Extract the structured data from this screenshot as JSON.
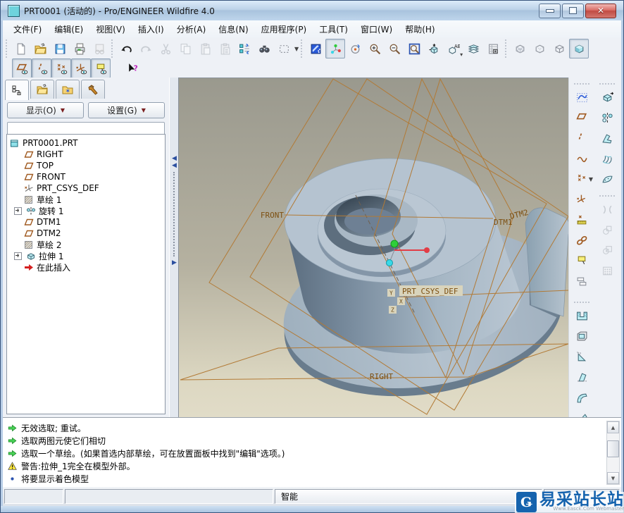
{
  "title_bar": {
    "title": "PRT0001 (活动的) - Pro/ENGINEER Wildfire 4.0"
  },
  "menu_bar": {
    "items": [
      "文件(F)",
      "编辑(E)",
      "视图(V)",
      "插入(I)",
      "分析(A)",
      "信息(N)",
      "应用程序(P)",
      "工具(T)",
      "窗口(W)",
      "帮助(H)"
    ]
  },
  "toolbar_top": {
    "file_group": [
      "new-file-icon",
      "open-file-icon",
      "save-icon",
      "print-icon",
      "send-mail-icon"
    ],
    "edit_group": [
      "undo-icon",
      "redo-icon",
      "cut-icon",
      "copy-icon",
      "paste-icon",
      "paste-special-icon",
      "regenerate-icon",
      "find-icon",
      "select-box-icon"
    ],
    "view_group": [
      "repaint-icon",
      "spin-center-icon",
      "orient-mode-icon",
      "zoom-in-icon",
      "zoom-out-icon",
      "zoom-fit-icon",
      "reorient-view-icon",
      "saved-views-icon",
      "layers-icon",
      "view-manager-icon"
    ],
    "display_group": [
      "wireframe-icon",
      "hidden-line-icon",
      "no-hidden-icon",
      "shaded-icon"
    ],
    "pressed": [
      "spin-center-icon",
      "shaded-icon"
    ]
  },
  "toolbar_datum": [
    "datum-plane-display-icon",
    "datum-axis-display-icon",
    "point-display-icon",
    "csys-display-icon",
    "annotation-display-icon",
    "context-help-icon"
  ],
  "navigator": {
    "tabs": [
      "model-tree-tab",
      "folder-browser-tab",
      "favorites-tab",
      "connections-tab"
    ],
    "show_button": "显示(O)",
    "settings_button": "设置(G)",
    "tree": [
      {
        "label": "PRT0001.PRT",
        "icon": "part-icon"
      },
      {
        "label": "RIGHT",
        "icon": "datum-plane-icon"
      },
      {
        "label": "TOP",
        "icon": "datum-plane-icon"
      },
      {
        "label": "FRONT",
        "icon": "datum-plane-icon"
      },
      {
        "label": "PRT_CSYS_DEF",
        "icon": "csys-icon"
      },
      {
        "label": "草绘 1",
        "icon": "sketch-icon"
      },
      {
        "label": "旋转 1",
        "icon": "revolve-icon",
        "expandable": true
      },
      {
        "label": "DTM1",
        "icon": "datum-plane-icon"
      },
      {
        "label": "DTM2",
        "icon": "datum-plane-icon"
      },
      {
        "label": "草绘 2",
        "icon": "sketch-icon"
      },
      {
        "label": "拉伸 1",
        "icon": "extrude-icon",
        "expandable": true
      },
      {
        "label": "在此插入",
        "icon": "insert-here-icon"
      }
    ]
  },
  "viewport": {
    "labels": {
      "front": "FRONT",
      "right": "RIGHT",
      "dtm1": "DTM1",
      "dtm2": "DTM2",
      "csys": "PRT_CSYS_DEF",
      "ax": "X",
      "ay": "Y",
      "az": "Z"
    }
  },
  "right_toolbar": {
    "datum_tools": [
      "sketch-tool-icon",
      "datum-plane-icon",
      "datum-axis-icon",
      "datum-curve-icon",
      "datum-point-icon",
      "datum-csys-icon",
      "measure-icon",
      "udf-icon",
      "note-icon",
      "annotation-icon"
    ],
    "feature_tools": [
      "extrude-tool-icon",
      "revolve-tool-icon",
      "sweep-tool-icon",
      "boundary-blend-icon",
      "style-tool-icon",
      "merge-icon",
      "trim-icon",
      "offset-icon",
      "pattern-icon"
    ],
    "engineering_tools": [
      "hole-tool-icon",
      "shell-tool-icon",
      "rib-tool-icon",
      "draft-tool-icon",
      "round-tool-icon",
      "chamfer-tool-icon"
    ]
  },
  "messages": [
    {
      "icon": "prompt-arrow-icon",
      "text": "无效选取; 重试。"
    },
    {
      "icon": "prompt-arrow-icon",
      "text": "选取两图元使它们相切"
    },
    {
      "icon": "prompt-arrow-icon",
      "text": "选取一个草绘。(如果首选内部草绘，可在放置面板中找到\"编辑\"选项。)"
    },
    {
      "icon": "warning-icon",
      "text": "警告:拉伸_1完全在模型外部。"
    },
    {
      "icon": "info-bullet-icon",
      "text": "将要显示着色模型"
    }
  ],
  "status_bar": {
    "filter_value": "智能"
  },
  "watermark": {
    "title": "易采站长站",
    "subtitle": "Www.Easck.Com Webmaster"
  },
  "colors": {
    "datum_orange": "#b27a35",
    "label_brown": "#7d5012",
    "model_light": "#b5c3d0",
    "model_dark": "#5a6c7e",
    "title_blue": "#bcd2e8",
    "watermark_blue": "#1563ae"
  }
}
